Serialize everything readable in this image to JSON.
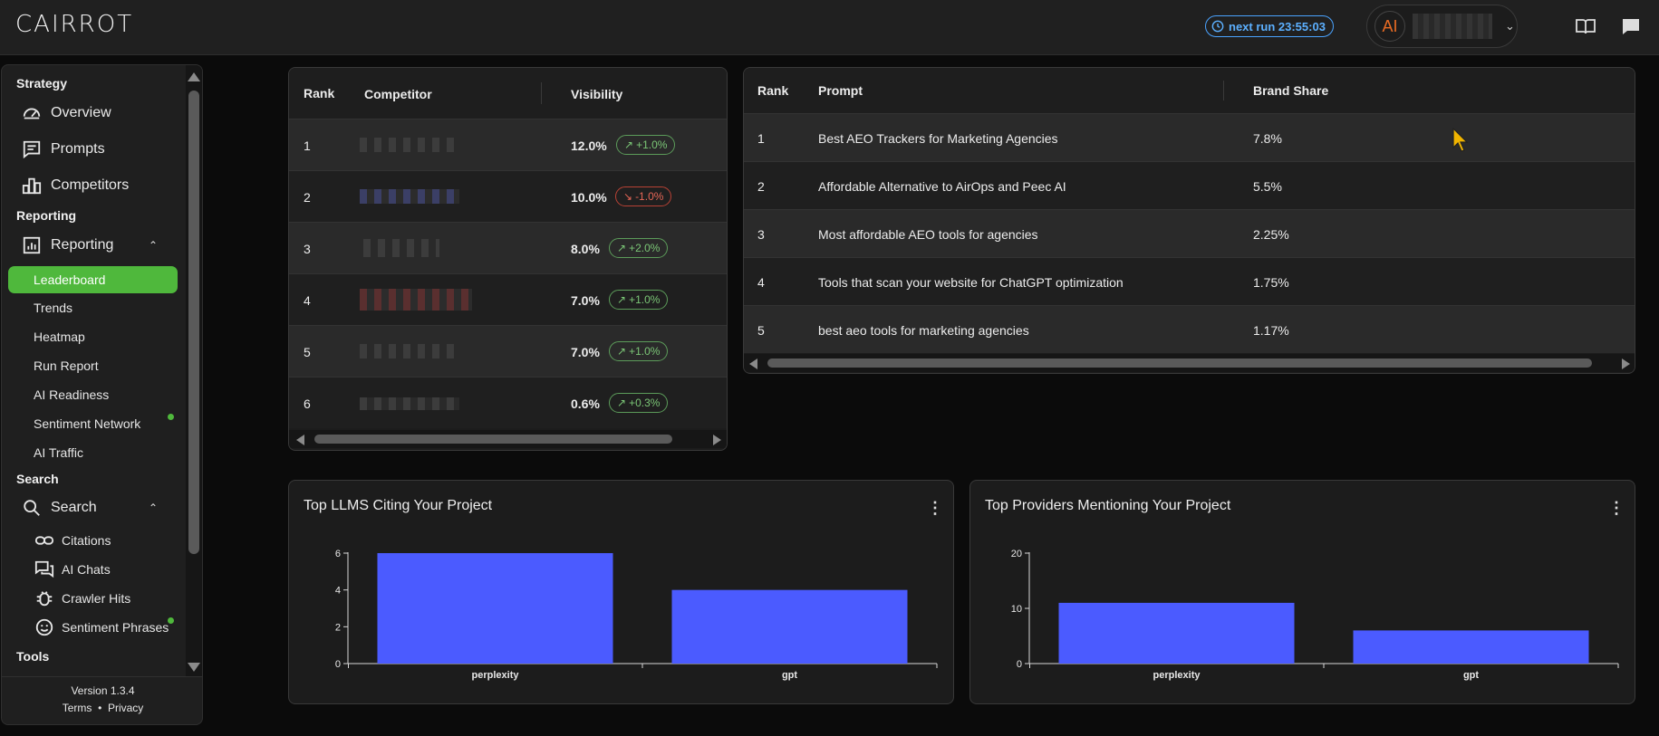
{
  "app": {
    "logo": "CAIRROT",
    "next_run_label": "next run 23:55:03",
    "avatar_text": "AI"
  },
  "sidebar": {
    "sections": {
      "strategy": "Strategy",
      "reporting": "Reporting",
      "search": "Search",
      "tools": "Tools"
    },
    "strategy_items": [
      "Overview",
      "Prompts",
      "Competitors"
    ],
    "reporting_group": "Reporting",
    "reporting_items": [
      "Leaderboard",
      "Trends",
      "Heatmap",
      "Run Report",
      "AI Readiness",
      "Sentiment Network",
      "AI Traffic"
    ],
    "search_group": "Search",
    "search_items": [
      "Citations",
      "AI Chats",
      "Crawler Hits",
      "Sentiment Phrases"
    ],
    "version": "Version 1.3.4",
    "terms": "Terms",
    "privacy": "Privacy",
    "separator": "•"
  },
  "competitors_table": {
    "headers": [
      "Rank",
      "Competitor",
      "Visibility"
    ],
    "rows": [
      {
        "rank": "1",
        "visibility": "12.0%",
        "change": "+1.0%",
        "direction": "up"
      },
      {
        "rank": "2",
        "visibility": "10.0%",
        "change": "-1.0%",
        "direction": "down"
      },
      {
        "rank": "3",
        "visibility": "8.0%",
        "change": "+2.0%",
        "direction": "up"
      },
      {
        "rank": "4",
        "visibility": "7.0%",
        "change": "+1.0%",
        "direction": "up"
      },
      {
        "rank": "5",
        "visibility": "7.0%",
        "change": "+1.0%",
        "direction": "up"
      },
      {
        "rank": "6",
        "visibility": "0.6%",
        "change": "+0.3%",
        "direction": "up"
      }
    ]
  },
  "prompts_table": {
    "headers": [
      "Rank",
      "Prompt",
      "Brand Share"
    ],
    "rows": [
      {
        "rank": "1",
        "prompt": "Best AEO Trackers for Marketing Agencies",
        "share": "7.8%"
      },
      {
        "rank": "2",
        "prompt": "Affordable Alternative to AirOps and Peec AI",
        "share": "5.5%"
      },
      {
        "rank": "3",
        "prompt": "Most affordable AEO tools for agencies",
        "share": "2.25%"
      },
      {
        "rank": "4",
        "prompt": "Tools that scan your website for ChatGPT optimization",
        "share": "1.75%"
      },
      {
        "rank": "5",
        "prompt": "best aeo tools for marketing agencies",
        "share": "1.17%"
      }
    ]
  },
  "charts": {
    "llms_title": "Top LLMS Citing Your Project",
    "providers_title": "Top Providers Mentioning Your Project"
  },
  "chart_data": [
    {
      "type": "bar",
      "title": "Top LLMS Citing Your Project",
      "categories": [
        "perplexity",
        "gpt"
      ],
      "values": [
        6,
        4
      ],
      "ylim": [
        0,
        6
      ],
      "yticks": [
        0,
        2,
        4,
        6
      ],
      "color": "#4b5bff"
    },
    {
      "type": "bar",
      "title": "Top Providers Mentioning Your Project",
      "categories": [
        "perplexity",
        "gpt"
      ],
      "values": [
        11,
        6
      ],
      "ylim": [
        0,
        20
      ],
      "yticks": [
        0,
        10,
        20
      ],
      "color": "#4b5bff"
    }
  ],
  "colors": {
    "accent_green": "#4fb83c",
    "link_blue": "#5cb0ff",
    "bar_blue": "#4b5bff",
    "up": "#7bc676",
    "down": "#e56656"
  }
}
